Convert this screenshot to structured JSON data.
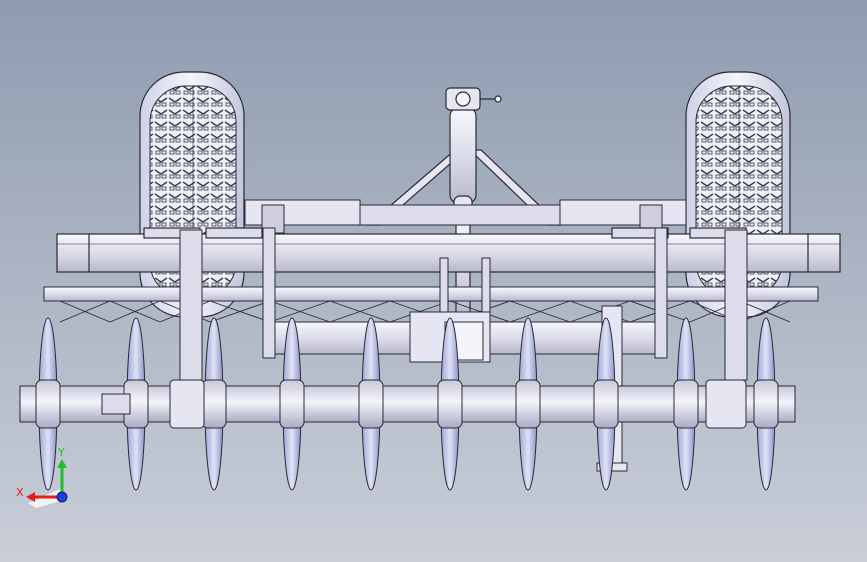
{
  "viewport": {
    "background_top": "#8e9bb0",
    "background_bottom": "#c9ced8",
    "model_face_color": "#e6e6f2",
    "model_edge_color": "#2a2a35",
    "disc_tint": "#b9bfe6"
  },
  "triad": {
    "x_label": "X",
    "y_label": "Y",
    "x_color": "#e0201c",
    "y_color": "#1fbf2a",
    "z_color": "#1c3fe0"
  }
}
